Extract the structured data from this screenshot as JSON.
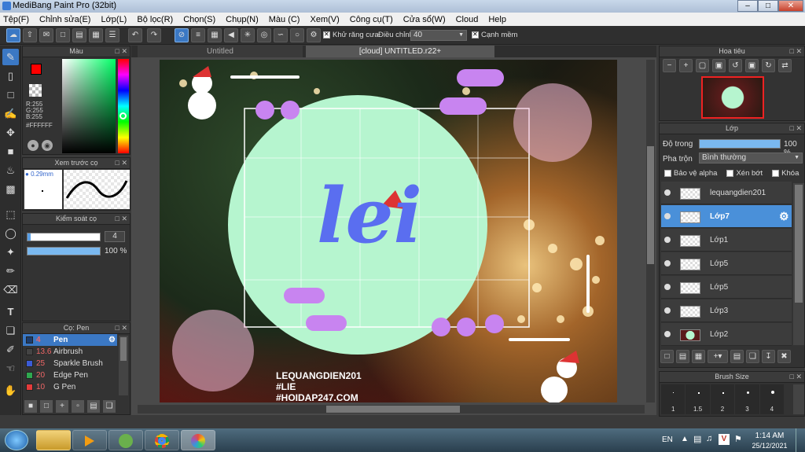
{
  "app": {
    "title": "MediBang Paint Pro (32bit)"
  },
  "menu": [
    "Tệp(F)",
    "Chỉnh sửa(E)",
    "Lớp(L)",
    "Bộ lọc(R)",
    "Chọn(S)",
    "Chụp(N)",
    "Màu (C)",
    "Xem(V)",
    "Công cụ(T)",
    "Cửa sổ(W)",
    "Cloud",
    "Help"
  ],
  "toolbar": {
    "antialias_label": "Khử răng cưa",
    "correction_label": "Điều chỉnh",
    "correction_value": "40",
    "sharp_edge_label": "Cạnh mềm"
  },
  "color_panel": {
    "title": "Màu",
    "r": "R:255",
    "g": "G:255",
    "b": "B:255",
    "hex": "#FFFFFF",
    "primary_color": "#ff0000",
    "secondary_color": "#ffffff"
  },
  "brush_preview": {
    "title": "Xem trước cọ",
    "size": "0.29mm"
  },
  "brush_control": {
    "title": "Kiểm soát cọ",
    "size_value": "4",
    "opacity_value": "100 %",
    "opacity_fraction": 1.0
  },
  "brush_panel": {
    "title": "Cọ: Pen",
    "brushes": [
      {
        "size": "4",
        "name": "Pen",
        "color": "#1c3c6c",
        "selected": true
      },
      {
        "size": "13.6",
        "name": "Airbrush",
        "color": "#444444",
        "selected": false
      },
      {
        "size": "25",
        "name": "Sparkle Brush",
        "color": "#3b5bd6",
        "selected": false
      },
      {
        "size": "20",
        "name": "Edge Pen",
        "color": "#2fa84f",
        "selected": false
      },
      {
        "size": "10",
        "name": "G Pen",
        "color": "#e43b3b",
        "selected": false
      }
    ]
  },
  "tabs": [
    {
      "label": "Untitled",
      "active": false
    },
    {
      "label": "[cloud] UNTITLED.r22+",
      "active": true
    }
  ],
  "canvas": {
    "logo_text": "lei",
    "watermark_lines": [
      "LEQUANGDIEN201",
      "#LIE",
      "#HOIDAP247.COM"
    ]
  },
  "navigator": {
    "title": "Hoa tiêu"
  },
  "layer_panel": {
    "title": "Lớp",
    "opacity_label": "Độ trong",
    "opacity_value": "100 %",
    "opacity_fraction": 1.0,
    "blend_label": "Pha trộn",
    "blend_value": "Bình thường",
    "protect_alpha": "Bảo vệ alpha",
    "clipping": "Xén bớt",
    "lock": "Khóa",
    "layers": [
      {
        "name": "lequangdien201",
        "selected": false
      },
      {
        "name": "Lớp7",
        "selected": true
      },
      {
        "name": "Lớp1",
        "selected": false
      },
      {
        "name": "Lớp5",
        "selected": false
      },
      {
        "name": "Lớp5",
        "selected": false
      },
      {
        "name": "Lớp3",
        "selected": false
      },
      {
        "name": "Lớp2",
        "selected": false
      }
    ]
  },
  "brush_size_panel": {
    "title": "Brush Size",
    "sizes": [
      "1",
      "1.5",
      "2",
      "3",
      "4"
    ]
  },
  "taskbar": {
    "language": "EN",
    "time": "1:14 AM",
    "date": "25/12/2021"
  }
}
